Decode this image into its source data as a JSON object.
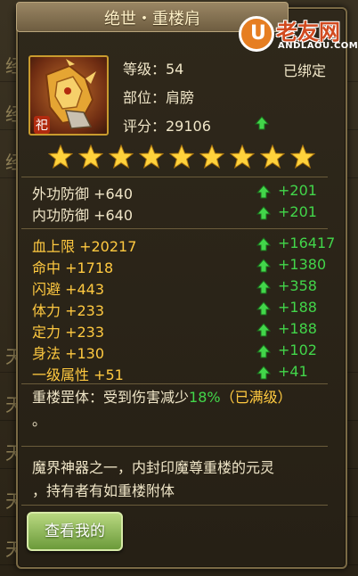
{
  "background": {
    "rows": [
      "经",
      "经",
      "经",
      "",
      "",
      "",
      "",
      "",
      "",
      "天",
      "天",
      "天",
      "天",
      "天"
    ]
  },
  "tooltip": {
    "title": "绝世・重楼肩",
    "item_badge": "祀",
    "level": "等级：54",
    "bound_status": "已绑定",
    "slot": "部位：肩膀",
    "score": "评分：29106",
    "star_count": 9,
    "defense_stats": [
      {
        "label": "外功防御 +640",
        "bonus": "+201"
      },
      {
        "label": "内功防御 +640",
        "bonus": "+201"
      }
    ],
    "attr_stats": [
      {
        "label": "血上限 +20217",
        "bonus": "+16417"
      },
      {
        "label": "命中 +1718",
        "bonus": "+1380"
      },
      {
        "label": "闪避 +443",
        "bonus": "+358"
      },
      {
        "label": "体力 +233",
        "bonus": "+188"
      },
      {
        "label": "定力 +233",
        "bonus": "+188"
      },
      {
        "label": "身法 +130",
        "bonus": "+102"
      },
      {
        "label": "一级属性 +51",
        "bonus": "+41"
      }
    ],
    "skill": {
      "prefix": "重楼罡体：受到伤害减少",
      "percent": "18%",
      "suffix": "（已满级）",
      "line2": "。"
    },
    "description_line1": "魔界神器之一，内封印魔尊重楼的元灵",
    "description_line2": "，持有者有如重楼附体",
    "view_button": "查看我的"
  },
  "watermark": {
    "brand": "老友网",
    "url": "ANDLAOU.COM"
  },
  "colors": {
    "gold": "#ffc940",
    "green": "#42d64a",
    "text": "#f0e6c8"
  }
}
